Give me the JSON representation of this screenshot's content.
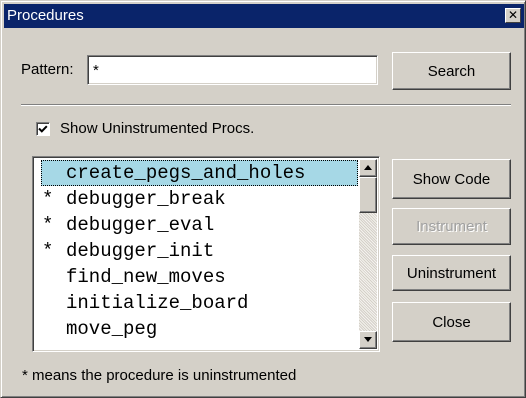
{
  "window": {
    "title": "Procedures",
    "close_glyph": "✕"
  },
  "pattern": {
    "label": "Pattern:",
    "value": "*"
  },
  "buttons": {
    "search": "Search",
    "show_code": "Show Code",
    "instrument": "Instrument",
    "uninstrument": "Uninstrument",
    "close": "Close"
  },
  "show_uninstrumented": {
    "label": "Show Uninstrumented Procs.",
    "checked": true
  },
  "procedures": {
    "items": [
      {
        "mark": "",
        "name": "create_pegs_and_holes",
        "selected": true
      },
      {
        "mark": "*",
        "name": "debugger_break",
        "selected": false
      },
      {
        "mark": "*",
        "name": "debugger_eval",
        "selected": false
      },
      {
        "mark": "*",
        "name": "debugger_init",
        "selected": false
      },
      {
        "mark": "",
        "name": "find_new_moves",
        "selected": false
      },
      {
        "mark": "",
        "name": "initialize_board",
        "selected": false
      },
      {
        "mark": "",
        "name": "move_peg",
        "selected": false
      }
    ]
  },
  "footnote": "* means the procedure is uninstrumented",
  "colors": {
    "titlebar": "#0a246a",
    "selection": "#a6d8e6",
    "face": "#d4d0c8",
    "disabled_text": "#a0a0a0"
  }
}
